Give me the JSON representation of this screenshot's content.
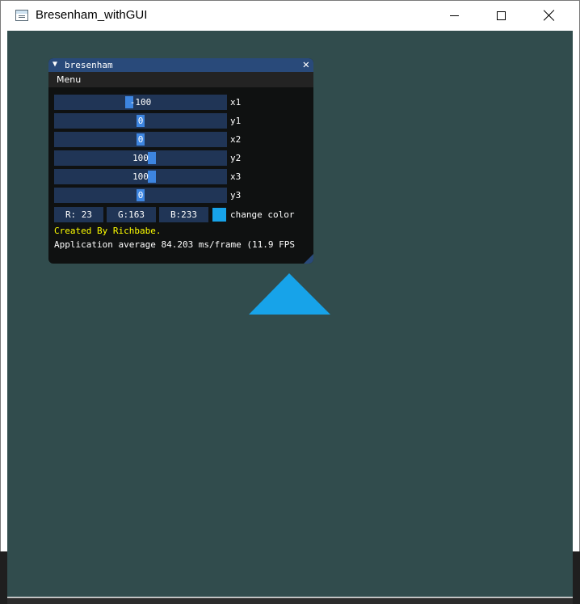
{
  "window": {
    "title": "Bresenham_withGUI",
    "buttons": [
      "minimize",
      "maximize",
      "close"
    ]
  },
  "canvas": {
    "background": "#314c4d",
    "shape": {
      "kind": "triangle",
      "fill": "#17a3e9"
    }
  },
  "panel": {
    "title": "bresenham",
    "close_glyph": "✕",
    "collapse_glyph": "▼",
    "menu": {
      "label": "Menu"
    },
    "sliders": [
      {
        "label": "x1",
        "value": "-100",
        "fraction": 0.43
      },
      {
        "label": "y1",
        "value": "0",
        "fraction": 0.5
      },
      {
        "label": "x2",
        "value": "0",
        "fraction": 0.5
      },
      {
        "label": "y2",
        "value": "100",
        "fraction": 0.57
      },
      {
        "label": "x3",
        "value": "100",
        "fraction": 0.57
      },
      {
        "label": "y3",
        "value": "0",
        "fraction": 0.5
      }
    ],
    "color": {
      "r": "R: 23",
      "g": "G:163",
      "b": "B:233",
      "swatch": "#17a3e9",
      "label": "change color"
    },
    "credit": "Created By Richbabe.",
    "perf": "Application average 84.203 ms/frame (11.9 FPS"
  }
}
